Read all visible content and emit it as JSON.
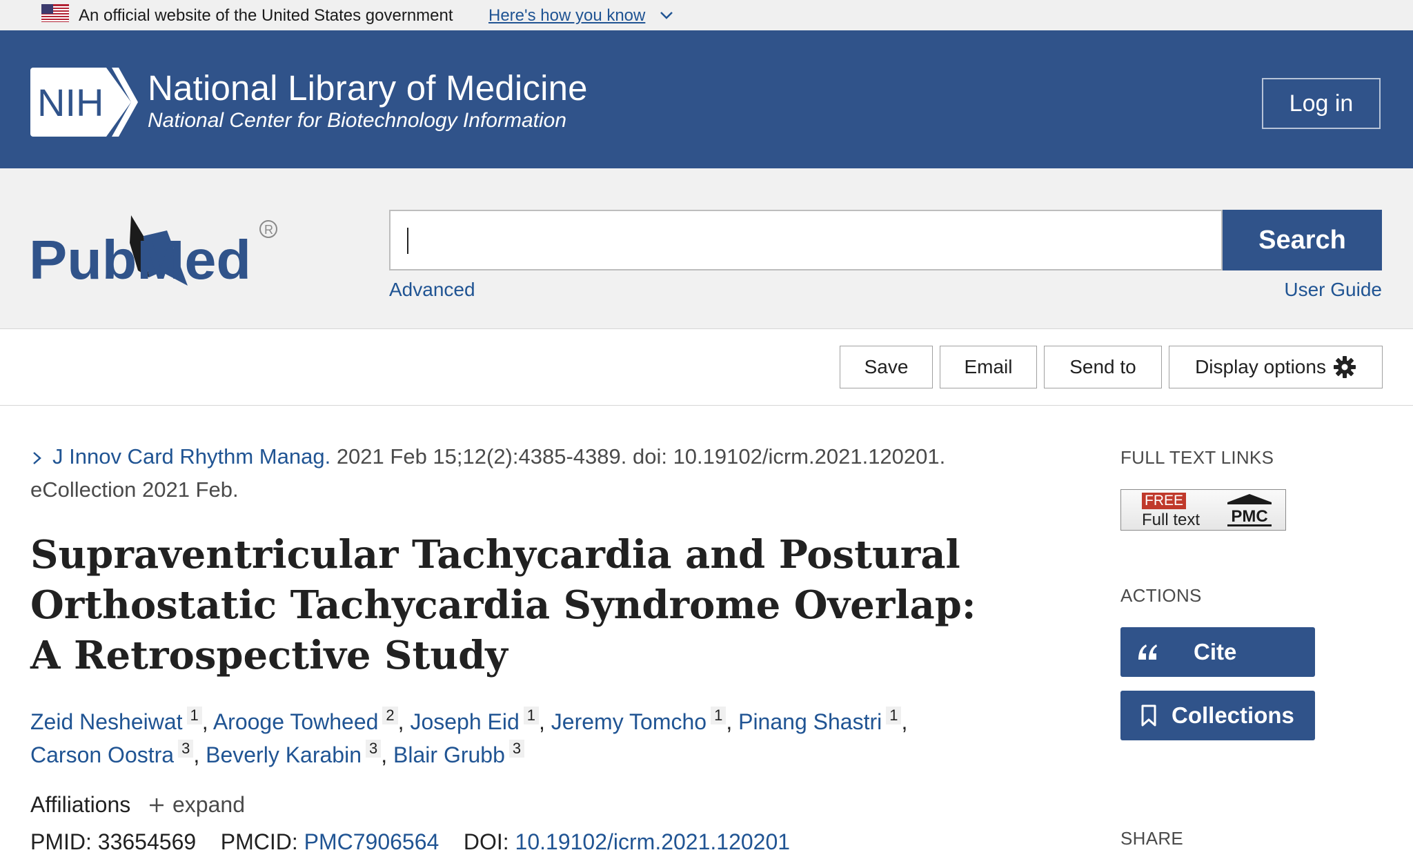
{
  "gov_banner": {
    "text": "An official website of the United States government",
    "link": "Here's how you know"
  },
  "header": {
    "logo_text": "NIH",
    "title": "National Library of Medicine",
    "subtitle": "National Center for Biotechnology Information",
    "login": "Log in"
  },
  "search": {
    "logo_text": "PubMed",
    "value": "",
    "button": "Search",
    "advanced": "Advanced",
    "user_guide": "User Guide"
  },
  "toolbar": {
    "save": "Save",
    "email": "Email",
    "send_to": "Send to",
    "display_options": "Display options"
  },
  "article": {
    "journal": "J Innov Card Rhythm Manag.",
    "citation": "2021 Feb 15;12(2):4385-4389. doi: 10.19102/icrm.2021.120201. eCollection 2021 Feb.",
    "title": "Supraventricular Tachycardia and Postural Orthostatic Tachycardia Syndrome Overlap: A Retrospective Study",
    "authors": [
      {
        "name": "Zeid Nesheiwat",
        "aff": "1"
      },
      {
        "name": "Arooge Towheed",
        "aff": "2"
      },
      {
        "name": "Joseph Eid",
        "aff": "1"
      },
      {
        "name": "Jeremy Tomcho",
        "aff": "1"
      },
      {
        "name": "Pinang Shastri",
        "aff": "1"
      },
      {
        "name": "Carson Oostra",
        "aff": "3"
      },
      {
        "name": "Beverly Karabin",
        "aff": "3"
      },
      {
        "name": "Blair Grubb",
        "aff": "3"
      }
    ],
    "affiliations_label": "Affiliations",
    "expand": "expand",
    "pmid_label": "PMID:",
    "pmid": "33654569",
    "pmcid_label": "PMCID:",
    "pmcid": "PMC7906564",
    "doi_label": "DOI:",
    "doi": "10.19102/icrm.2021.120201"
  },
  "sidebar": {
    "full_text_links": "FULL TEXT LINKS",
    "badge_free": "FREE",
    "badge_full_text": "Full text",
    "badge_pmc": "PMC",
    "actions": "ACTIONS",
    "cite": "Cite",
    "collections": "Collections",
    "share": "SHARE"
  },
  "colors": {
    "brand_blue": "#30538a",
    "link_blue": "#205493",
    "free_red": "#c0392b"
  }
}
